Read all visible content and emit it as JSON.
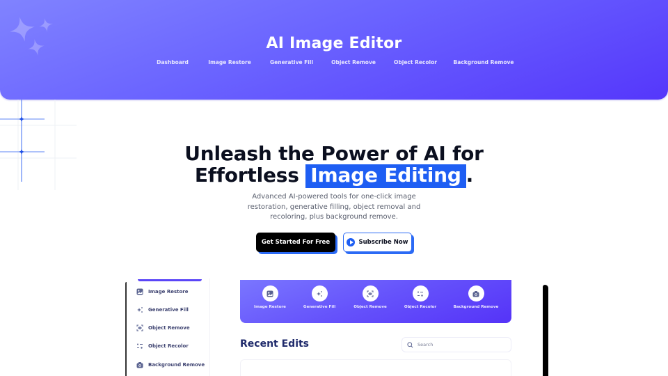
{
  "header": {
    "title": "AI Image Editor",
    "nav": [
      {
        "label": "Dashboard"
      },
      {
        "label": "Image Restore"
      },
      {
        "label": "Generative Fill"
      },
      {
        "label": "Object Remove"
      },
      {
        "label": "Object Recolor"
      },
      {
        "label": "Background Remove"
      }
    ],
    "colors": {
      "gradient_start": "#8083ff",
      "gradient_end": "#5537fb"
    }
  },
  "hero": {
    "title_line1": "Unleash the Power of AI for",
    "title_line2_prefix": "Effortless ",
    "title_highlight": "Image Editing",
    "title_suffix": ".",
    "subtitle": "Advanced AI-powered tools for one-click image restoration, generative filling, object removal and recoloring, plus background remove.",
    "primary_button": "Get Started For Free",
    "secondary_button": "Subscribe Now",
    "accent_color": "#1e5ef3"
  },
  "dashboard": {
    "sidebar": [
      {
        "label": "Image Restore",
        "icon": "image-icon"
      },
      {
        "label": "Generative Fill",
        "icon": "sparkles-icon"
      },
      {
        "label": "Object Remove",
        "icon": "scan-object-icon"
      },
      {
        "label": "Object Recolor",
        "icon": "recolor-icon"
      },
      {
        "label": "Background Remove",
        "icon": "camera-icon"
      }
    ],
    "tools": [
      {
        "label": "Image Restore",
        "icon": "image-icon"
      },
      {
        "label": "Generative Fill",
        "icon": "sparkles-icon"
      },
      {
        "label": "Object Remove",
        "icon": "scan-object-icon"
      },
      {
        "label": "Object Recolor",
        "icon": "recolor-icon"
      },
      {
        "label": "Background Remove",
        "icon": "camera-icon"
      }
    ],
    "recent_title": "Recent Edits",
    "search_placeholder": "Search"
  }
}
